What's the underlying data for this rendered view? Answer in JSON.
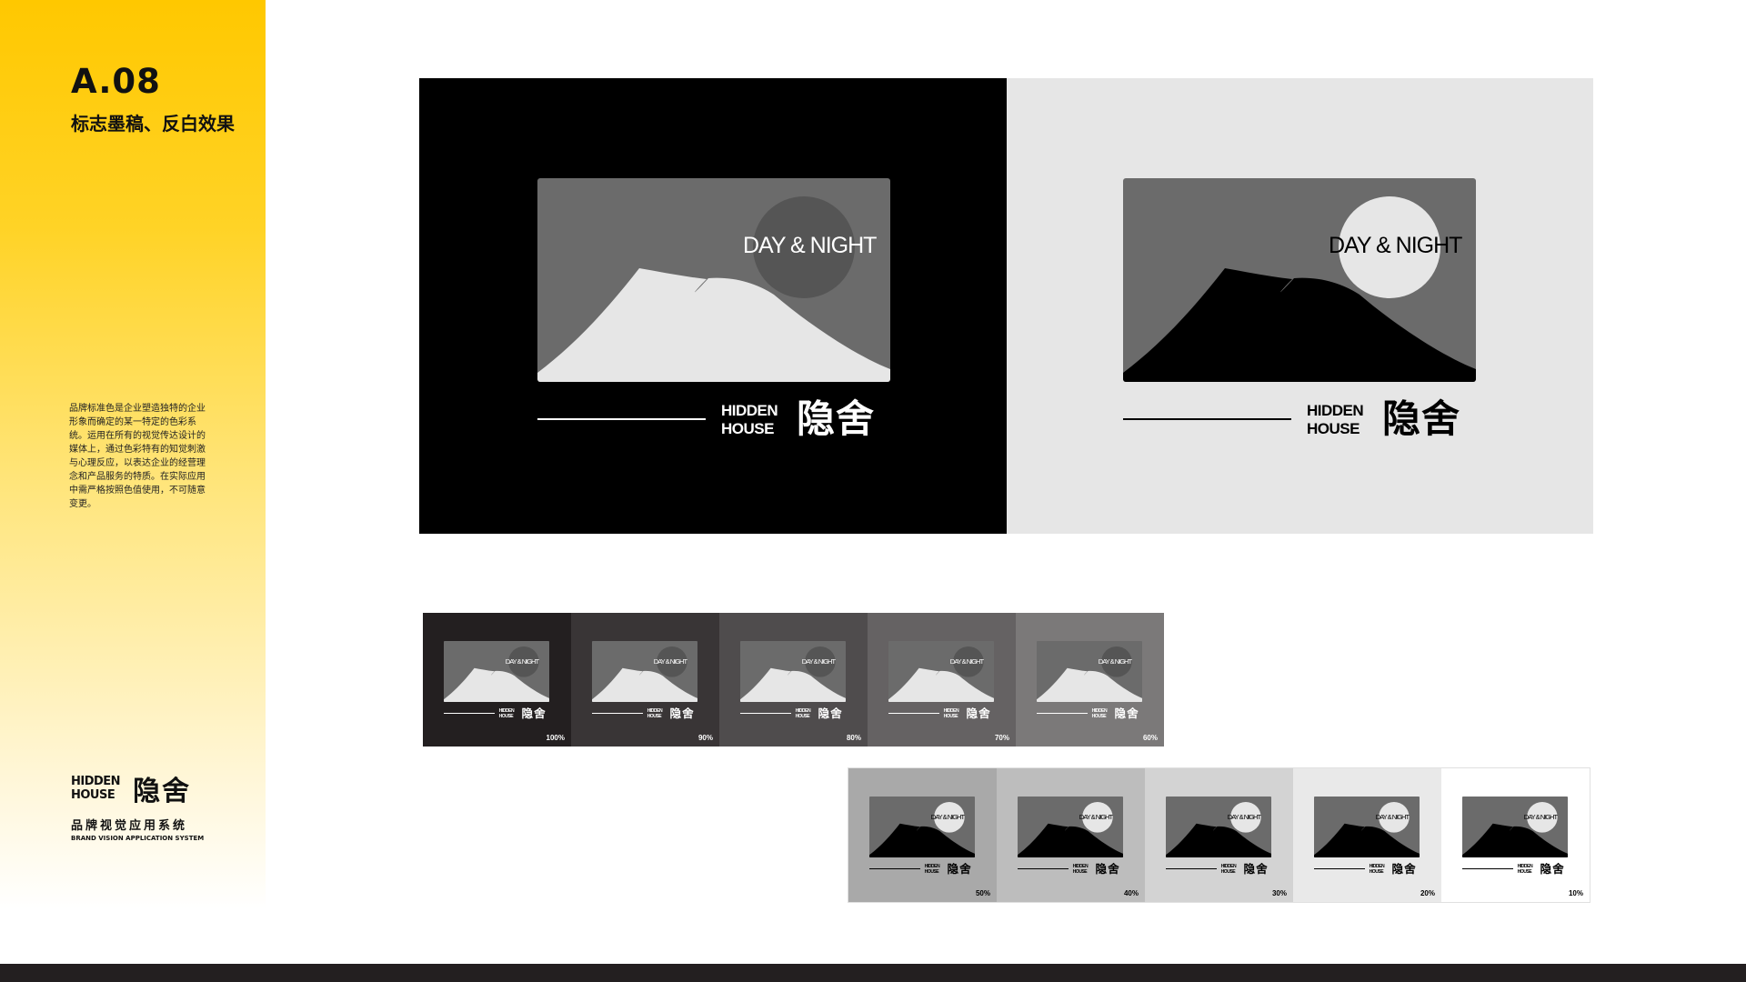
{
  "sidebar": {
    "section_number": "A.08",
    "section_title": "标志墨稿、反白效果",
    "description": "品牌标准色是企业塑造独特的企业形象而确定的某一特定的色彩系统。运用在所有的视觉传达设计的媒体上，通过色彩特有的知觉刺激与心理反应，以表达企业的经营理念和产品服务的特质。在实际应用中需严格按照色值使用，不可随意变更。",
    "brand_en_line1": "HIDDEN",
    "brand_en_line2": "HOUSE",
    "brand_cn": "隐舍",
    "system_cn": "品牌视觉应用系统",
    "system_en": "BRAND VISION APPLICATION SYSTEM"
  },
  "logo": {
    "tagline": "DAY & NIGHT",
    "name_en_line1": "HIDDEN",
    "name_en_line2": "HOUSE",
    "name_cn": "隐舍"
  },
  "tints_row1": [
    {
      "label": "100%",
      "bg": "#231f20"
    },
    {
      "label": "90%",
      "bg": "#393536"
    },
    {
      "label": "80%",
      "bg": "#4f4c4d"
    },
    {
      "label": "70%",
      "bg": "#656263"
    },
    {
      "label": "60%",
      "bg": "#7b7979"
    }
  ],
  "tints_row2": [
    {
      "label": "50%",
      "bg": "#a9a9a9"
    },
    {
      "label": "40%",
      "bg": "#bdbdbd"
    },
    {
      "label": "30%",
      "bg": "#d3d3d3"
    },
    {
      "label": "20%",
      "bg": "#e9e9e9"
    },
    {
      "label": "10%",
      "bg": "#ffffff"
    }
  ],
  "colors": {
    "accent_yellow": "#ffc800",
    "dark_panel": "#000000",
    "light_panel": "#e6e6e6",
    "logo_gray": "#6b6b6b",
    "mountain_light": "#e6e6e6",
    "mountain_dark": "#000000"
  }
}
